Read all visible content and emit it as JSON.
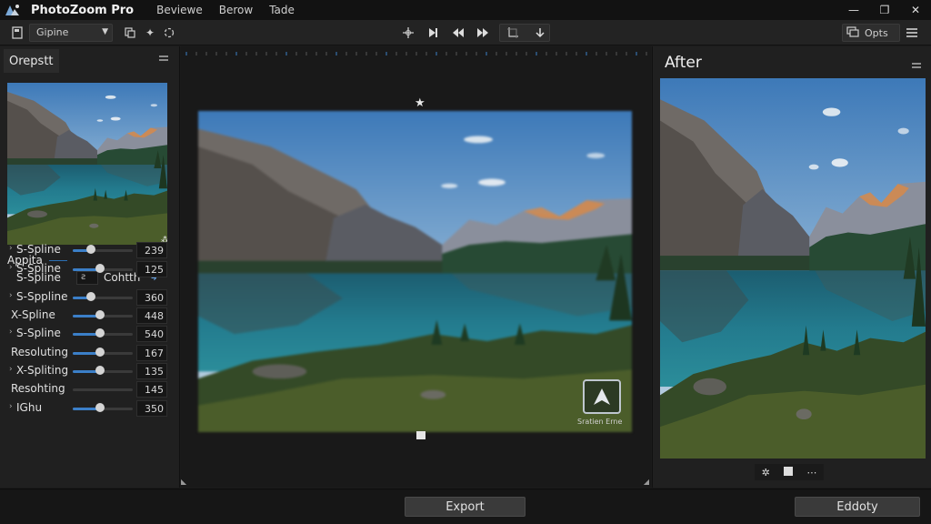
{
  "app": {
    "title": "PhotoZoom Pro"
  },
  "menu": [
    "Beviewe",
    "Berow",
    "Tade"
  ],
  "window_controls": {
    "minimize": "—",
    "maximize": "❐",
    "close": "✕"
  },
  "toolbar": {
    "preset": "Gipine",
    "options_label": "Opts"
  },
  "left_panel": {
    "tab": "Orepstt",
    "section_title": "Appita",
    "method_row": {
      "label": "S-Spline",
      "box": "ƨ",
      "mode": "Cohtth"
    },
    "rows": [
      {
        "label": "S-Spline",
        "prefix": "›",
        "value": "239",
        "level": 0.3
      },
      {
        "label": "S-Spline",
        "prefix": "›",
        "value": "125",
        "level": 0.45
      },
      {
        "label": "S-Sppline",
        "prefix": "›",
        "value": "360",
        "level": 0.3
      },
      {
        "label": "X-Spline",
        "prefix": "",
        "value": "448",
        "level": 0.45
      },
      {
        "label": "S-Spline",
        "prefix": "›",
        "value": "540",
        "level": 0.45
      },
      {
        "label": "Resoluting",
        "prefix": "",
        "value": "167",
        "level": 0.45
      },
      {
        "label": "X-Spliting",
        "prefix": "›",
        "value": "135",
        "level": 0.45
      },
      {
        "label": "Resohting",
        "prefix": "",
        "value": "145",
        "level": 0
      },
      {
        "label": "IGhu",
        "prefix": "›",
        "value": "350",
        "level": 0.45
      }
    ]
  },
  "center": {
    "nav_label": "Sratien Erne"
  },
  "right_panel": {
    "title": "After"
  },
  "buttons": {
    "export": "Export",
    "secondary": "Eddoty"
  },
  "colors": {
    "accent": "#3b7fc8",
    "background": "#1b1b1b",
    "panel": "#202020"
  }
}
